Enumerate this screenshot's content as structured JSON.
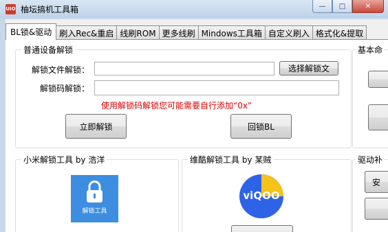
{
  "window": {
    "title": "柚坛搞机工具箱",
    "app_icon": "UIO",
    "minimize_icon": "—",
    "maximize_icon": "□",
    "close_icon": "✕"
  },
  "tabs": [
    {
      "label": "BL锁&驱动",
      "active": true
    },
    {
      "label": "刷入Rec&重启"
    },
    {
      "label": "线刷ROM"
    },
    {
      "label": "更多线刷"
    },
    {
      "label": "Mindows工具箱"
    },
    {
      "label": "自定义刷入"
    },
    {
      "label": "格式化&提取"
    }
  ],
  "unlock_group": {
    "title": "普通设备解锁",
    "file_label": "解锁文件解锁：",
    "file_value": "",
    "browse_button": "选择解锁文",
    "code_label": "解锁码解锁：",
    "code_value": "",
    "warning": "使用解锁码解锁您可能需要自行添加“0x”",
    "unlock_button": "立即解锁",
    "relock_button": "回锁BL"
  },
  "basic_group": {
    "title": "基本命"
  },
  "xiaomi_group": {
    "title": "小米解锁工具 by 浩洋",
    "icon_label": "解锁工具"
  },
  "vivo_group": {
    "title": "维酷解锁工具 by 某贼",
    "icon_label": "viQOO"
  },
  "driver_group": {
    "title": "驱动补",
    "button": "安"
  },
  "colors": {
    "accent": "#3d8de0",
    "warning": "#d40000",
    "vivo": "#2f63e6",
    "vivo_accent": "#f5c218"
  }
}
